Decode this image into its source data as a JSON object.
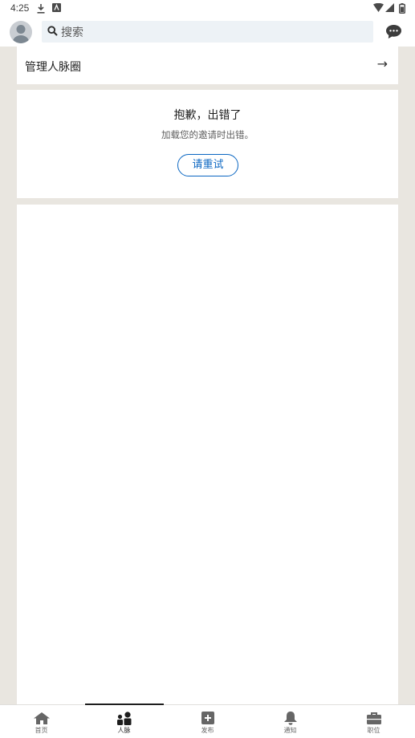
{
  "status_bar": {
    "time": "4:25"
  },
  "header": {
    "search_placeholder": "搜索"
  },
  "manage": {
    "label": "管理人脉圈",
    "arrow": "→"
  },
  "error": {
    "title": "抱歉，出错了",
    "description": "加载您的邀请时出错。",
    "retry_label": "请重试"
  },
  "bottom_nav": {
    "items": [
      {
        "label": "首页",
        "icon": "home-icon"
      },
      {
        "label": "人脉",
        "icon": "network-icon"
      },
      {
        "label": "发布",
        "icon": "post-icon"
      },
      {
        "label": "通知",
        "icon": "bell-icon"
      },
      {
        "label": "职位",
        "icon": "briefcase-icon"
      }
    ],
    "active_index": 1
  },
  "colors": {
    "accent": "#0a66c2",
    "page_bg": "#e9e6e0",
    "search_bg": "#edf2f6"
  }
}
